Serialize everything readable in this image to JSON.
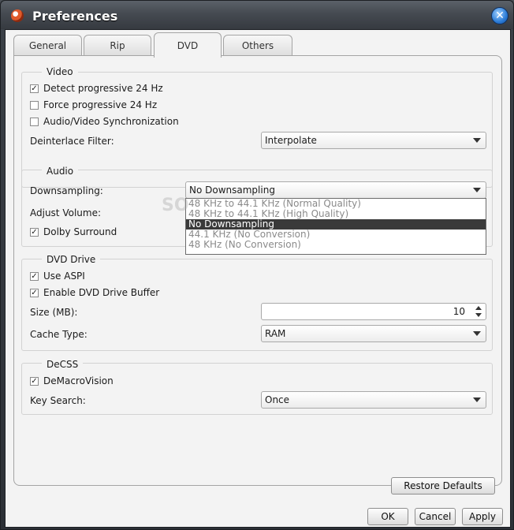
{
  "window": {
    "title": "Preferences",
    "close_glyph": "✕"
  },
  "tabs": [
    {
      "label": "General"
    },
    {
      "label": "Rip"
    },
    {
      "label": "DVD"
    },
    {
      "label": "Others"
    }
  ],
  "video": {
    "title": "Video",
    "detect_progressive": {
      "label": "Detect progressive 24 Hz",
      "checked": true
    },
    "force_progressive": {
      "label": "Force progressive 24 Hz",
      "checked": false
    },
    "av_sync": {
      "label": "Audio/Video Synchronization",
      "checked": false
    },
    "deinterlace_label": "Deinterlace Filter:",
    "deinterlace_value": "Interpolate"
  },
  "audio": {
    "title": "Audio",
    "downsampling_label": "Downsampling:",
    "downsampling_value": "No Downsampling",
    "adjust_volume_label": "Adjust Volume:",
    "dolby": {
      "label": "Dolby Surround",
      "checked": true
    },
    "options": [
      "48 KHz to 44.1 KHz (Normal Quality)",
      "48 KHz to 44.1 KHz (High Quality)",
      "No Downsampling",
      "44.1 KHz (No Conversion)",
      "48 KHz (No Conversion)"
    ],
    "selected_index": 2
  },
  "dvd_drive": {
    "title": "DVD Drive",
    "use_aspi": {
      "label": "Use ASPI",
      "checked": true
    },
    "enable_buffer": {
      "label": "Enable DVD Drive Buffer",
      "checked": true
    },
    "size_label": "Size (MB):",
    "size_value": "10",
    "cache_label": "Cache Type:",
    "cache_value": "RAM"
  },
  "decss": {
    "title": "DeCSS",
    "demacrovision": {
      "label": "DeMacroVision",
      "checked": true
    },
    "key_search_label": "Key Search:",
    "key_search_value": "Once"
  },
  "buttons": {
    "restore_defaults": "Restore Defaults",
    "ok": "OK",
    "cancel": "Cancel",
    "apply": "Apply"
  },
  "watermark": "SO",
  "check_glyph": "✓"
}
